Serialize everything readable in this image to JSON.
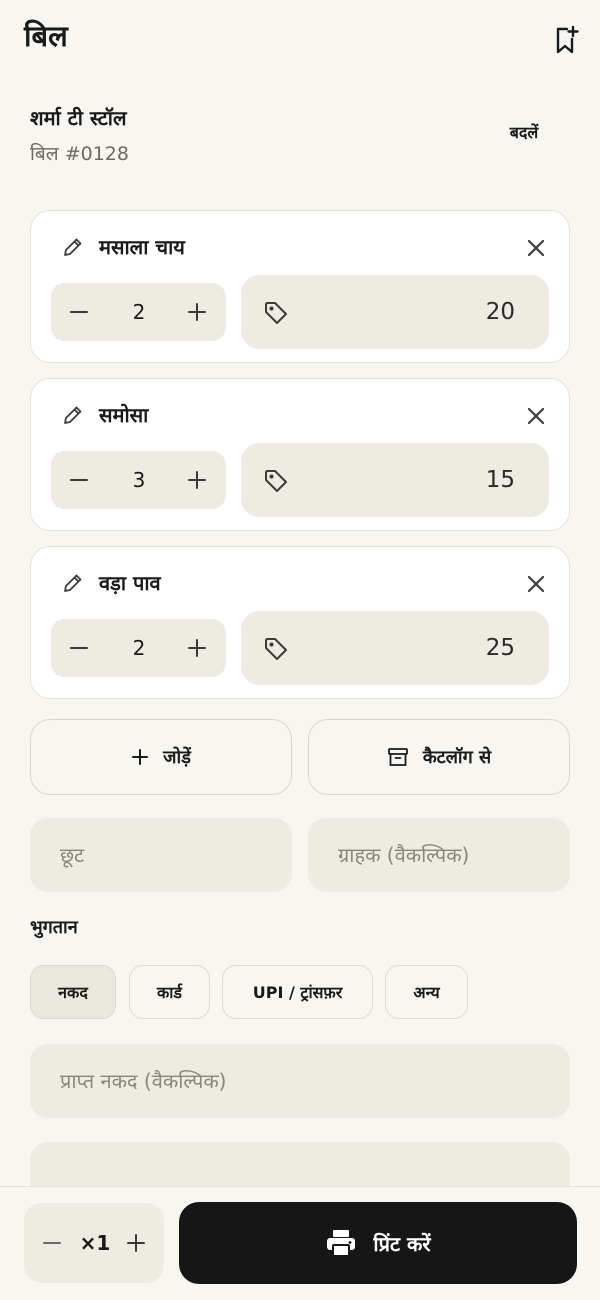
{
  "header": {
    "title": "बिल",
    "bookmark_icon": "bookmark-add-icon"
  },
  "store": {
    "name": "शर्मा टी स्टॉल",
    "bill_number": "बिल #0128",
    "change_label": "बदलें"
  },
  "items": [
    {
      "name": "मसाला चाय",
      "quantity": "2",
      "price": "20"
    },
    {
      "name": "समोसा",
      "quantity": "3",
      "price": "15"
    },
    {
      "name": "वड़ा पाव",
      "quantity": "2",
      "price": "25"
    }
  ],
  "actions": {
    "add_label": "जोड़ें",
    "catalog_label": "कैटलॉग से"
  },
  "inputs": {
    "discount_placeholder": "छूट",
    "customer_placeholder": "ग्राहक (वैकल्पिक)",
    "cash_received_placeholder": "प्राप्त नकद (वैकल्पिक)",
    "note_placeholder": ""
  },
  "payment": {
    "label": "भुगतान",
    "methods": [
      "नकद",
      "कार्ड",
      "UPI / ट्रांसफ़र",
      "अन्य"
    ],
    "selected": "नकद"
  },
  "footer": {
    "copies": "×1",
    "print_label": "प्रिंट करें"
  },
  "colors": {
    "background": "#f7f6f1",
    "card": "#ffffff",
    "field": "#eeebe3",
    "primary": "#161616",
    "placeholder": "#8a867e"
  }
}
